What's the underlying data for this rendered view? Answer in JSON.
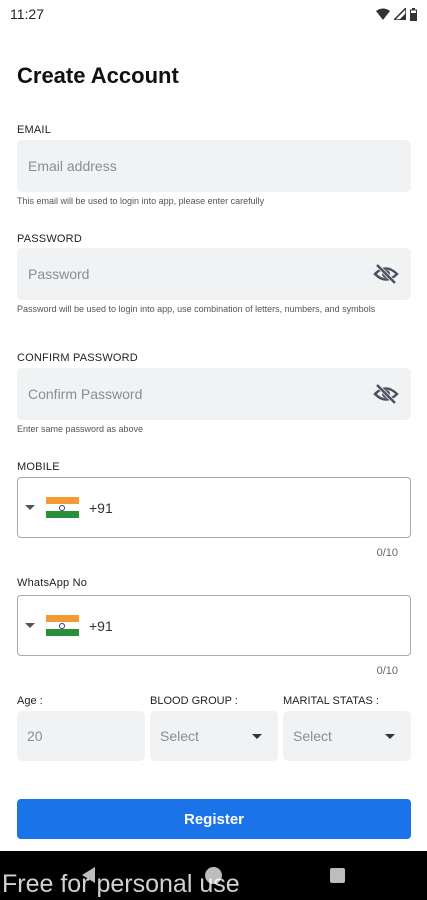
{
  "status_bar": {
    "time": "11:27"
  },
  "title": "Create Account",
  "email": {
    "label": "EMAIL",
    "placeholder": "Email address",
    "hint": "This email will be used to login into app, please enter carefully"
  },
  "password": {
    "label": "PASSWORD",
    "placeholder": "Password",
    "hint": "Password will be used to login into app, use combination of letters, numbers, and symbols"
  },
  "confirm_password": {
    "label": "CONFIRM PASSWORD",
    "placeholder": "Confirm Password",
    "hint": "Enter same password as above"
  },
  "mobile": {
    "label": "MOBILE",
    "country_code": "+91",
    "counter": "0/10"
  },
  "whatsapp": {
    "label": "WhatsApp No",
    "country_code": "+91",
    "counter": "0/10"
  },
  "age": {
    "label": "Age :",
    "placeholder": "20"
  },
  "blood_group": {
    "label": "BLOOD GROUP :",
    "value": "Select"
  },
  "marital_status": {
    "label": "MARITAL STATAS :",
    "value": "Select"
  },
  "register_label": "Register",
  "watermark": "Free for personal use",
  "colors": {
    "primary": "#1a73e8",
    "field_bg": "#f1f2f4"
  }
}
